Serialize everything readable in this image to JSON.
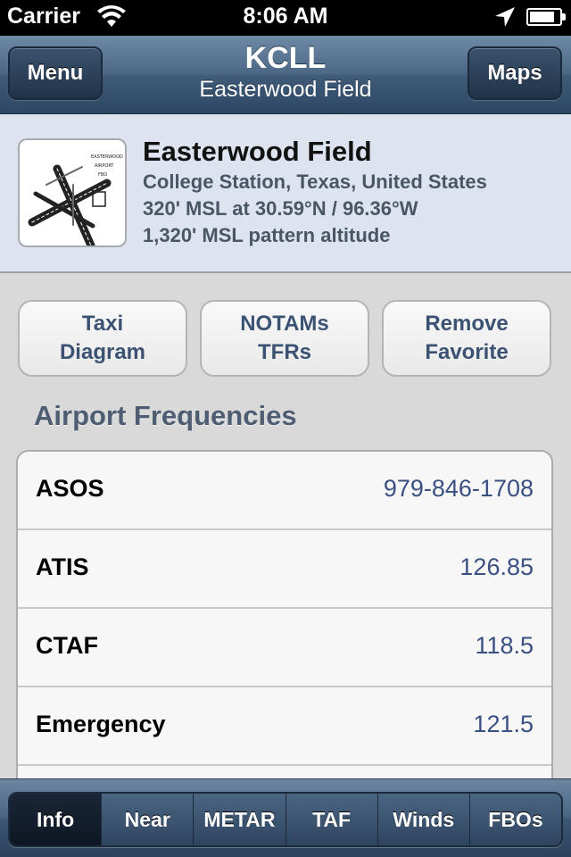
{
  "status_bar": {
    "carrier": "Carrier",
    "time": "8:06 AM",
    "wifi_icon": "wifi-icon",
    "location_icon": "location-arrow-icon",
    "battery_icon": "battery-icon",
    "battery_level": 0.85
  },
  "nav": {
    "menu_label": "Menu",
    "maps_label": "Maps",
    "title": "KCLL",
    "subtitle": "Easterwood Field"
  },
  "airport": {
    "diagram_icon": "airport-diagram-thumbnail",
    "diagram_text": [
      "EASTERWOOD",
      "AIRPORT",
      "FBO"
    ],
    "name": "Easterwood Field",
    "location": "College Station, Texas, United States",
    "elevation": "320' MSL at 30.59°N / 96.36°W",
    "pattern": "1,320' MSL pattern altitude"
  },
  "actions": {
    "taxi": [
      "Taxi",
      "Diagram"
    ],
    "notams": [
      "NOTAMs",
      "TFRs"
    ],
    "favorite": [
      "Remove",
      "Favorite"
    ]
  },
  "frequencies": {
    "title": "Airport Frequencies",
    "rows": [
      {
        "label": "ASOS",
        "value": "979-846-1708"
      },
      {
        "label": "ATIS",
        "value": "126.85"
      },
      {
        "label": "CTAF",
        "value": "118.5"
      },
      {
        "label": "Emergency",
        "value": "121.5"
      }
    ]
  },
  "tabs": {
    "items": [
      "Info",
      "Near",
      "METAR",
      "TAF",
      "Winds",
      "FBOs"
    ],
    "active": "Info"
  },
  "colors": {
    "nav_gradient_top": "#6f8aa6",
    "nav_gradient_bottom": "#2d4763",
    "header_bg": "#dde4ef",
    "link_text": "#3a5082",
    "button_text": "#3b5272"
  }
}
